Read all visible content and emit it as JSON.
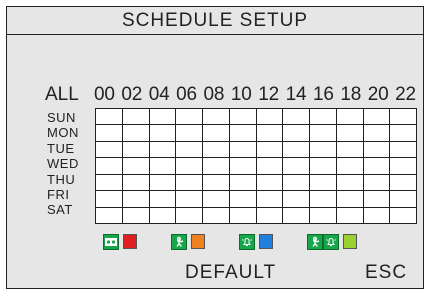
{
  "title": "SCHEDULE SETUP",
  "all_label": "ALL",
  "hours": [
    "00",
    "02",
    "04",
    "06",
    "08",
    "10",
    "12",
    "14",
    "16",
    "18",
    "20",
    "22"
  ],
  "days": [
    "SUN",
    "MON",
    "TUE",
    "WED",
    "THU",
    "FRI",
    "SAT"
  ],
  "legend": [
    {
      "icons": [
        "video-record-icon"
      ],
      "color": "#e02020"
    },
    {
      "icons": [
        "motion-person-icon"
      ],
      "color": "#f08020"
    },
    {
      "icons": [
        "alarm-bell-icon"
      ],
      "color": "#2080e0"
    },
    {
      "icons": [
        "motion-person-icon",
        "alarm-bell-icon"
      ],
      "color": "#9ad030"
    }
  ],
  "buttons": {
    "default_label": "DEFAULT",
    "esc_label": "ESC"
  }
}
